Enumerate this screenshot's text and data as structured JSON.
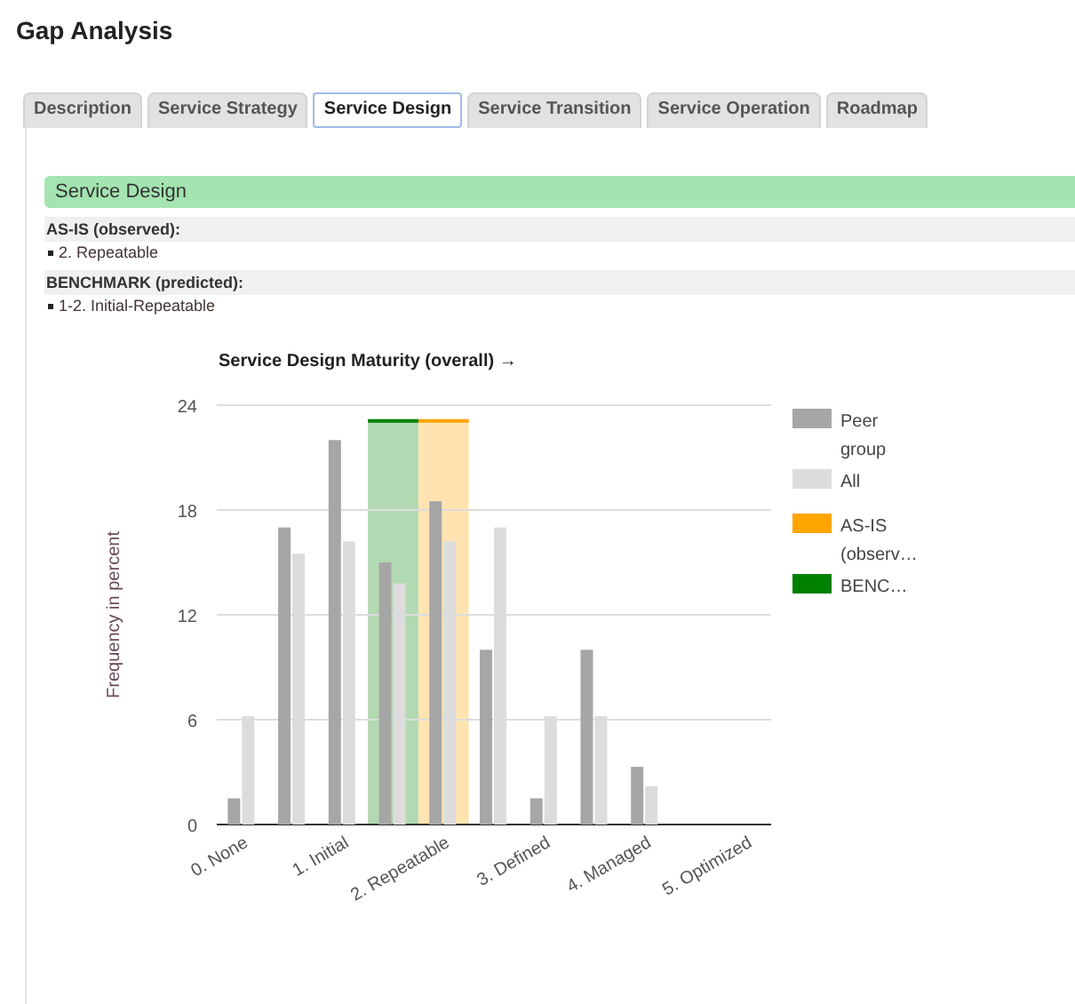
{
  "page_title": "Gap Analysis",
  "tabs": [
    {
      "label": "Description",
      "selected": false
    },
    {
      "label": "Service Strategy",
      "selected": false
    },
    {
      "label": "Service Design",
      "selected": true
    },
    {
      "label": "Service Transition",
      "selected": false
    },
    {
      "label": "Service Operation",
      "selected": false
    },
    {
      "label": "Roadmap",
      "selected": false
    }
  ],
  "section": {
    "title": "Service Design",
    "groups": [
      {
        "heading": "AS-IS (observed):",
        "items": [
          "2. Repeatable"
        ]
      },
      {
        "heading": "BENCHMARK (predicted):",
        "items": [
          "1-2. Initial-Repeatable"
        ]
      }
    ],
    "chart_data": {
      "type": "bar",
      "title": "Service Design Maturity (overall) →",
      "ylabel": "Frequency in percent",
      "x": [
        0,
        0.5,
        1,
        1.5,
        2,
        2.5,
        3,
        3.5,
        4
      ],
      "xlim": [
        -0.25,
        5.25
      ],
      "xticks": [
        {
          "value": 0,
          "label": "0. None"
        },
        {
          "value": 1,
          "label": "1. Initial"
        },
        {
          "value": 2,
          "label": "2. Repeatable"
        },
        {
          "value": 3,
          "label": "3. Defined"
        },
        {
          "value": 4,
          "label": "4. Managed"
        },
        {
          "value": 5,
          "label": "5. Optimized"
        }
      ],
      "ylim": [
        0,
        24
      ],
      "yticks": [
        0,
        6,
        12,
        18,
        24
      ],
      "grid": true,
      "legend": true,
      "series": [
        {
          "name": "Peer group",
          "color": "#a6a6a6",
          "values": [
            1.5,
            17,
            22,
            15,
            18.5,
            10,
            1.5,
            10,
            3.3
          ]
        },
        {
          "name": "All",
          "color": "#dcdcdc",
          "values": [
            6.2,
            15.5,
            16.2,
            13.8,
            16.2,
            17,
            6.2,
            6.2,
            2.2
          ]
        },
        {
          "name": "AS-IS (observ…",
          "color": "#ffa500",
          "values": [
            null,
            null,
            null,
            null,
            23.2,
            null,
            null,
            null,
            null
          ]
        },
        {
          "name": "BENC…",
          "color": "#008000",
          "values": [
            null,
            null,
            null,
            23.2,
            null,
            null,
            null,
            null,
            null
          ]
        }
      ]
    }
  }
}
